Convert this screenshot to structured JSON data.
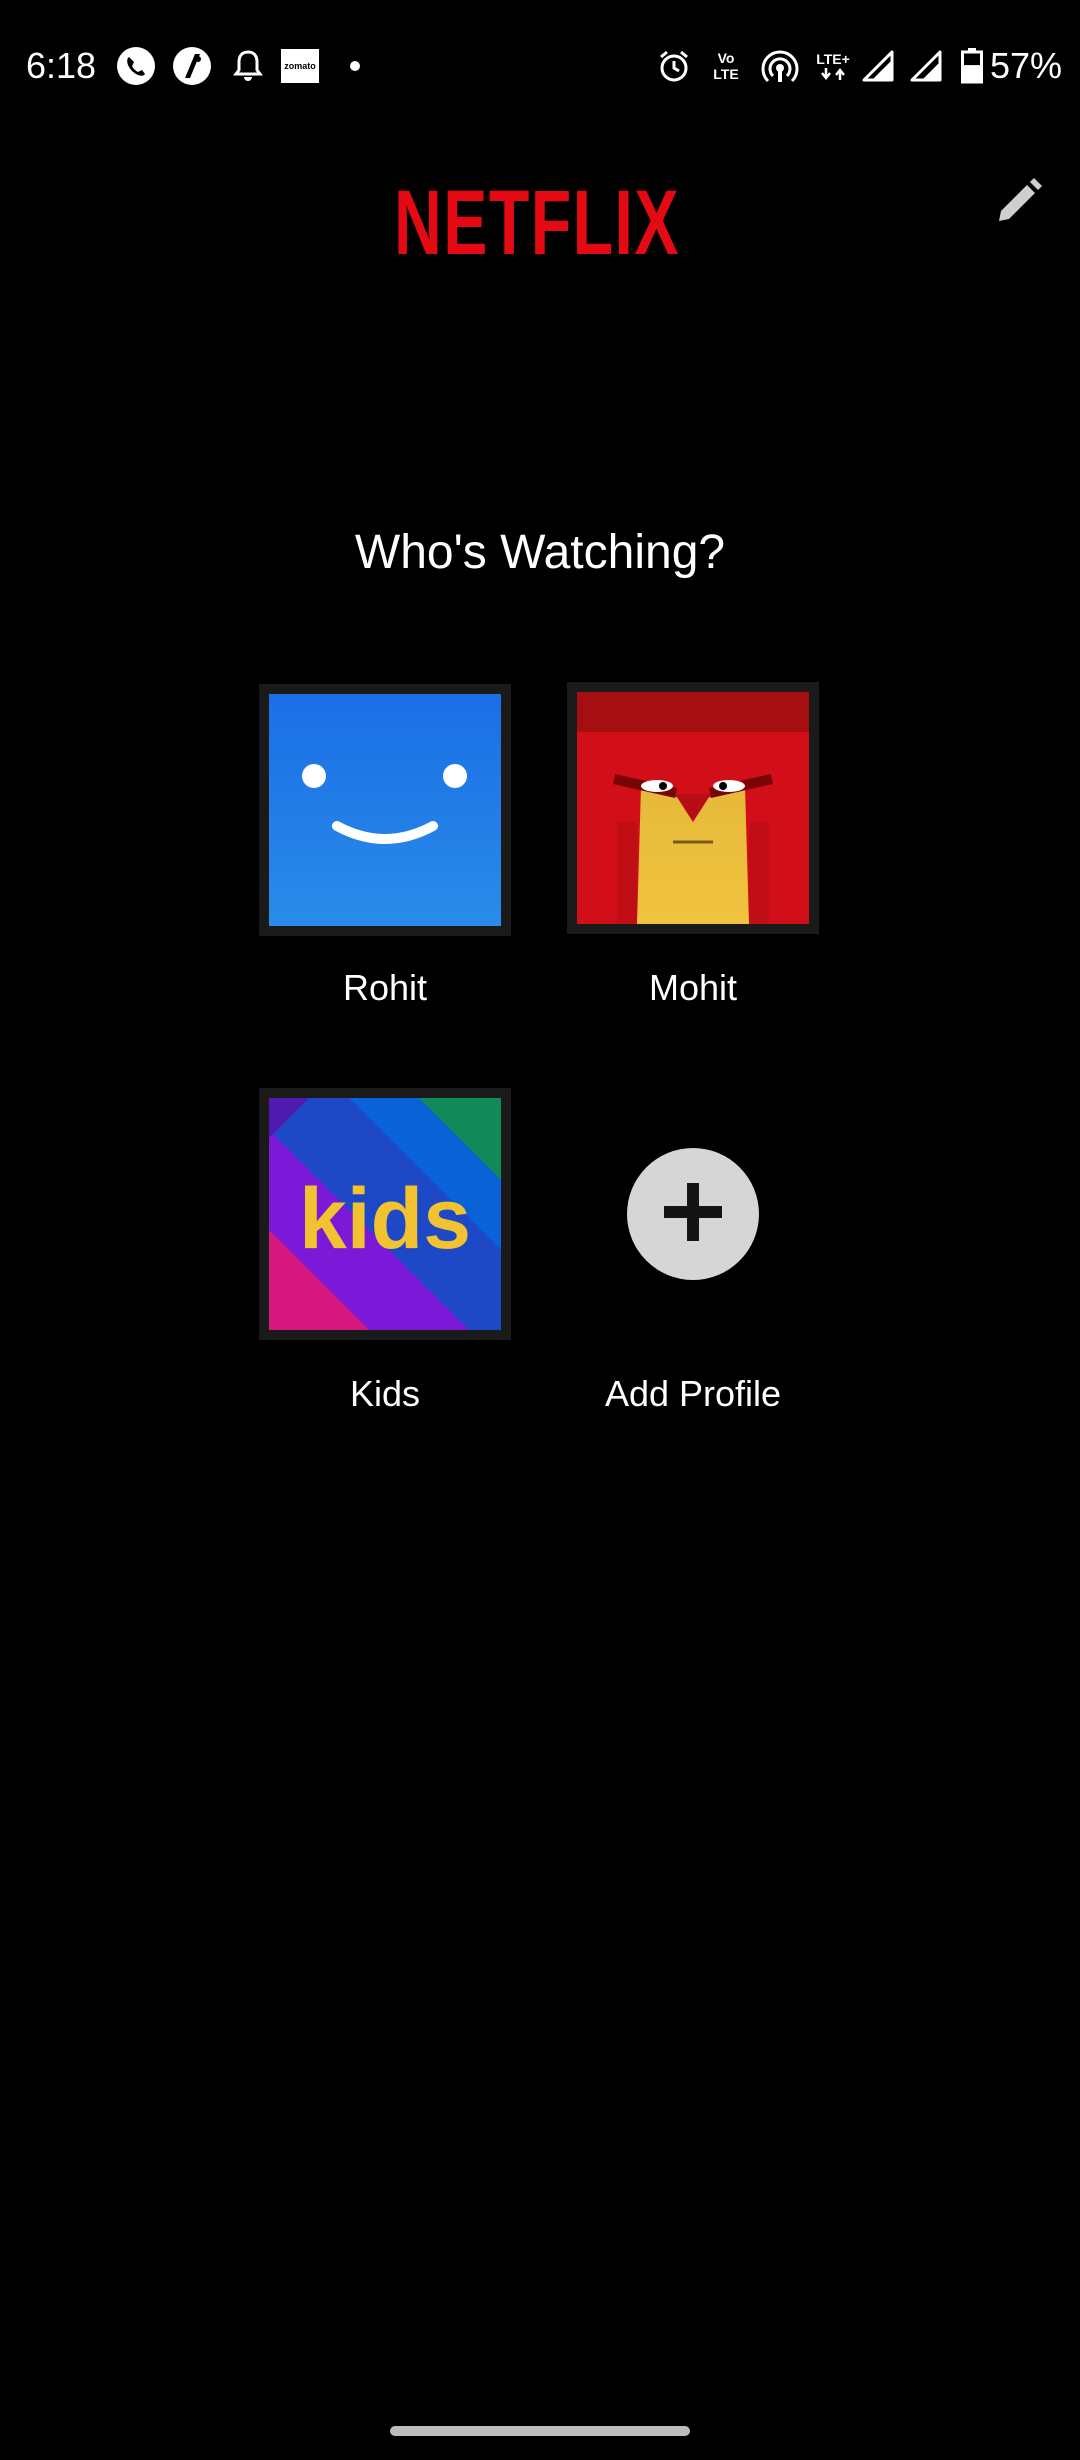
{
  "status_bar": {
    "time": "6:18",
    "left_icons": [
      "phone-call-icon",
      "app-notification-icon",
      "bell-icon",
      "zomato-icon",
      "dot-icon"
    ],
    "zomato_label": "zomato",
    "right_icons": [
      "alarm-icon",
      "volte-icon",
      "hotspot-icon",
      "lte-plus-icon",
      "signal-icon",
      "signal-icon-2",
      "battery-icon"
    ],
    "volte_line1": "Vo",
    "volte_line2": "LTE",
    "lte_plus_label": "LTE+",
    "battery_percent": "57%",
    "battery_level": 0.57
  },
  "header": {
    "logo_text": "NETFLIX",
    "logo_color": "#e50914",
    "edit_icon": "pencil-icon"
  },
  "main": {
    "title": "Who's Watching?",
    "profiles": [
      {
        "name": "Rohit",
        "avatar": "smiley-blue-avatar",
        "color": "#1e7be8"
      },
      {
        "name": "Mohit",
        "avatar": "red-yellow-face-avatar",
        "color": "#d0101a"
      },
      {
        "name": "Kids",
        "avatar": "kids-avatar",
        "avatar_text": "kids",
        "color": "#7a1ad8"
      }
    ],
    "add_profile": {
      "label": "Add Profile",
      "icon": "plus-icon"
    }
  }
}
